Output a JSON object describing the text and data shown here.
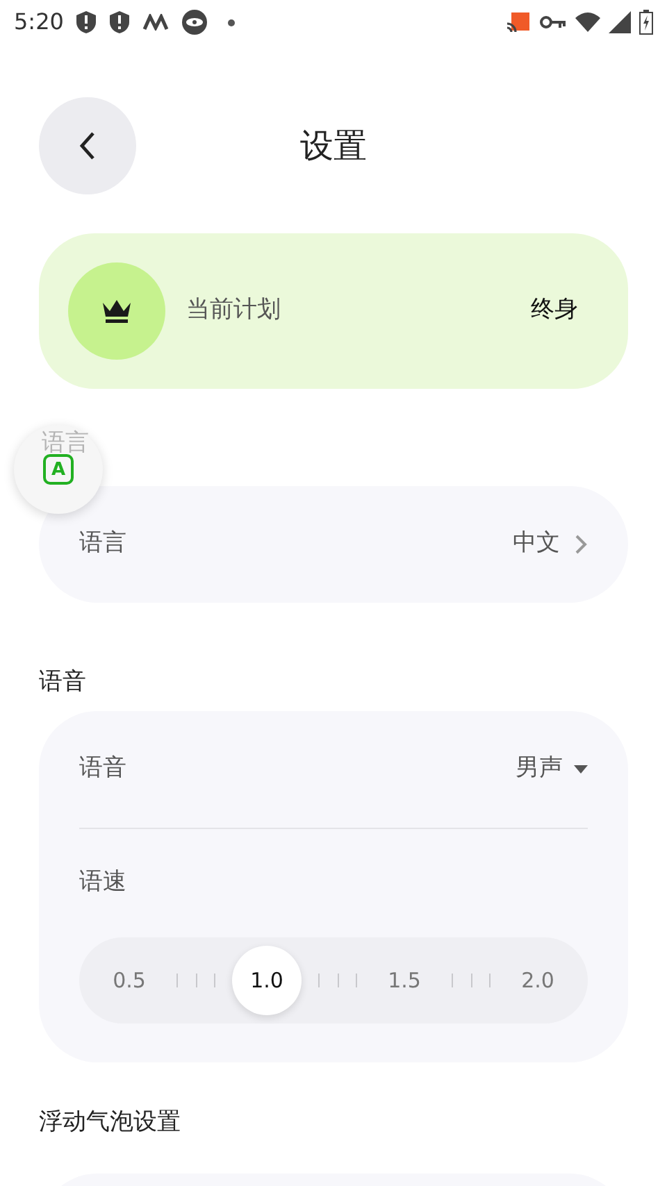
{
  "status_bar": {
    "time": "5:20"
  },
  "header": {
    "title": "设置"
  },
  "plan": {
    "label": "当前计划",
    "value": "终身"
  },
  "language_section": {
    "heading": "语言",
    "row": {
      "label": "语言",
      "value": "中文"
    }
  },
  "floating_bubble": {
    "label": "A"
  },
  "voice_section": {
    "heading": "语音",
    "voice": {
      "label": "语音",
      "value": "男声"
    },
    "speed": {
      "label": "语速",
      "options": [
        {
          "label": "0.5",
          "selected": false
        },
        {
          "label": "1.0",
          "selected": true
        },
        {
          "label": "1.5",
          "selected": false
        },
        {
          "label": "2.0",
          "selected": false
        }
      ]
    }
  },
  "bubble_section": {
    "heading": "浮动气泡设置"
  }
}
